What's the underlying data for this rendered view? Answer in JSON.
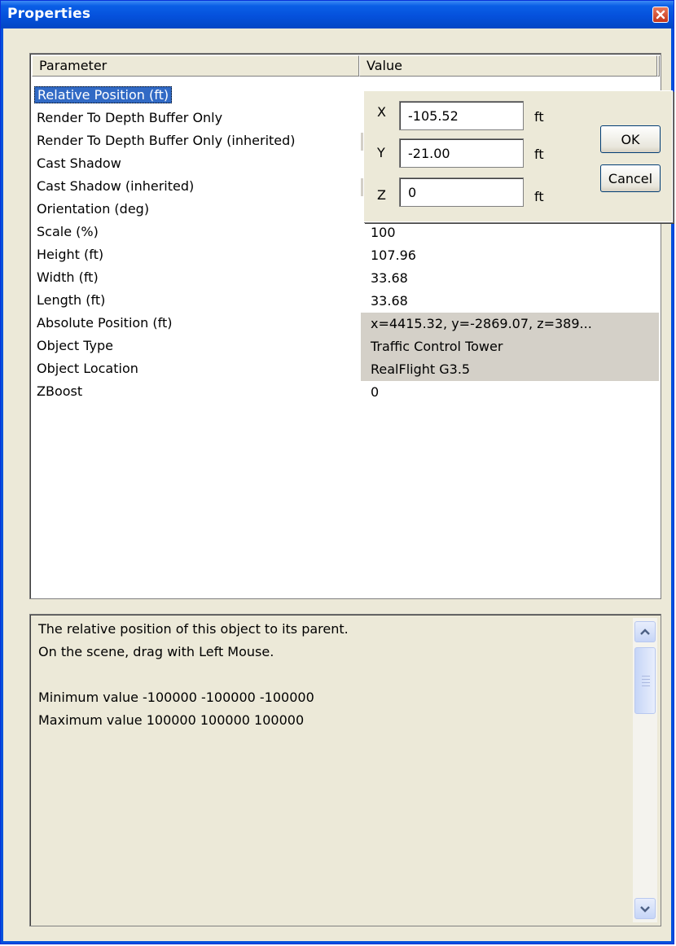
{
  "window": {
    "title": "Properties"
  },
  "grid": {
    "headers": {
      "parameter": "Parameter",
      "value": "Value"
    },
    "rows": [
      {
        "param": "Relative Position (ft)",
        "value": ""
      },
      {
        "param": "Render To Depth Buffer Only",
        "value": ""
      },
      {
        "param": "Render To Depth Buffer Only (inherited)",
        "value": ""
      },
      {
        "param": "Cast Shadow",
        "value": ""
      },
      {
        "param": "Cast Shadow (inherited)",
        "value": ""
      },
      {
        "param": "Orientation (deg)",
        "value": ""
      },
      {
        "param": "Scale (%)",
        "value": "100"
      },
      {
        "param": "Height (ft)",
        "value": "107.96"
      },
      {
        "param": "Width (ft)",
        "value": "33.68"
      },
      {
        "param": "Length (ft)",
        "value": "33.68"
      },
      {
        "param": "Absolute Position (ft)",
        "value": "x=4415.32, y=-2869.07, z=389..."
      },
      {
        "param": "Object Type",
        "value": "Traffic Control Tower"
      },
      {
        "param": "Object Location",
        "value": "RealFlight  G3.5"
      },
      {
        "param": "ZBoost",
        "value": "0"
      }
    ]
  },
  "position_editor": {
    "x": {
      "label": "X",
      "value": "-105.52",
      "unit": "ft"
    },
    "y": {
      "label": "Y",
      "value": "-21.00",
      "unit": "ft"
    },
    "z": {
      "label": "Z",
      "value": "0",
      "unit": "ft"
    },
    "ok_label": "OK",
    "cancel_label": "Cancel"
  },
  "description": {
    "line1": "The relative position of this object to its parent.",
    "line2": "On the scene, drag with Left Mouse.",
    "line3": "Minimum value -100000 -100000 -100000",
    "line4": "Maximum value 100000 100000 100000"
  }
}
